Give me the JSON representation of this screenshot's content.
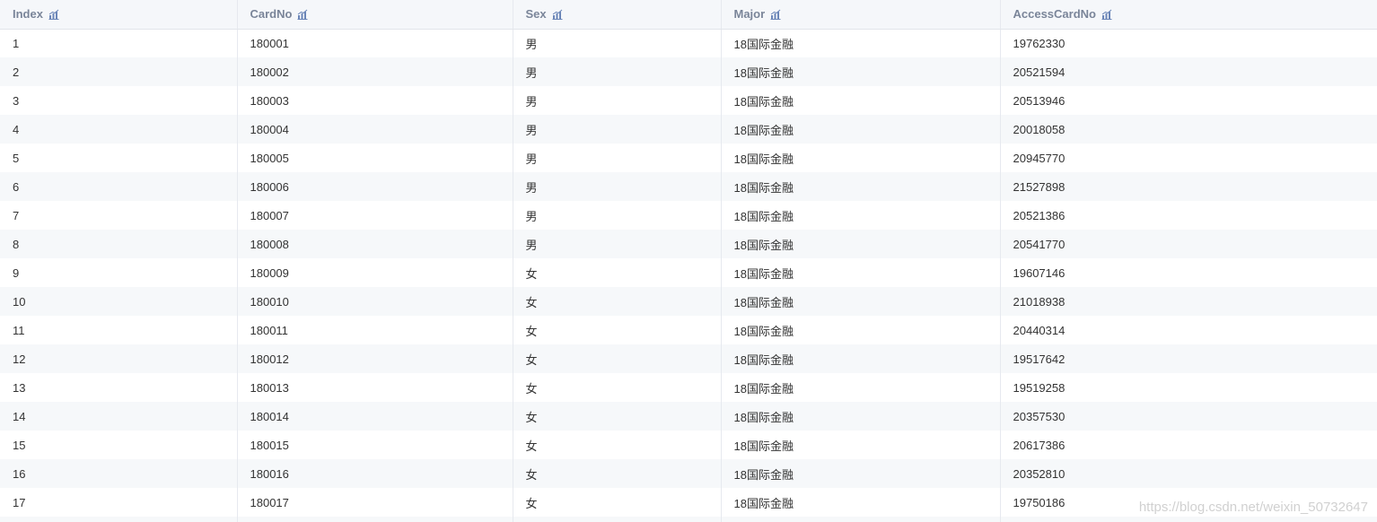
{
  "table": {
    "columns": [
      {
        "label": "Index",
        "icon": "sort-chart-icon"
      },
      {
        "label": "CardNo",
        "icon": "sort-chart-icon"
      },
      {
        "label": "Sex",
        "icon": "sort-chart-icon"
      },
      {
        "label": "Major",
        "icon": "sort-chart-icon"
      },
      {
        "label": "AccessCardNo",
        "icon": "sort-chart-icon"
      }
    ],
    "rows": [
      [
        "1",
        "180001",
        "男",
        "18国际金融",
        "19762330"
      ],
      [
        "2",
        "180002",
        "男",
        "18国际金融",
        "20521594"
      ],
      [
        "3",
        "180003",
        "男",
        "18国际金融",
        "20513946"
      ],
      [
        "4",
        "180004",
        "男",
        "18国际金融",
        "20018058"
      ],
      [
        "5",
        "180005",
        "男",
        "18国际金融",
        "20945770"
      ],
      [
        "6",
        "180006",
        "男",
        "18国际金融",
        "21527898"
      ],
      [
        "7",
        "180007",
        "男",
        "18国际金融",
        "20521386"
      ],
      [
        "8",
        "180008",
        "男",
        "18国际金融",
        "20541770"
      ],
      [
        "9",
        "180009",
        "女",
        "18国际金融",
        "19607146"
      ],
      [
        "10",
        "180010",
        "女",
        "18国际金融",
        "21018938"
      ],
      [
        "11",
        "180011",
        "女",
        "18国际金融",
        "20440314"
      ],
      [
        "12",
        "180012",
        "女",
        "18国际金融",
        "19517642"
      ],
      [
        "13",
        "180013",
        "女",
        "18国际金融",
        "19519258"
      ],
      [
        "14",
        "180014",
        "女",
        "18国际金融",
        "20357530"
      ],
      [
        "15",
        "180015",
        "女",
        "18国际金融",
        "20617386"
      ],
      [
        "16",
        "180016",
        "女",
        "18国际金融",
        "20352810"
      ],
      [
        "17",
        "180017",
        "女",
        "18国际金融",
        "19750186"
      ],
      [
        "",
        "",
        "",
        "",
        ""
      ]
    ]
  },
  "watermark": "https://blog.csdn.net/weixin_50732647",
  "colors": {
    "header_bg": "#f5f7fa",
    "header_text": "#7a8599",
    "stripe_bg": "#f6f8fa",
    "icon": "#6b86b8"
  }
}
